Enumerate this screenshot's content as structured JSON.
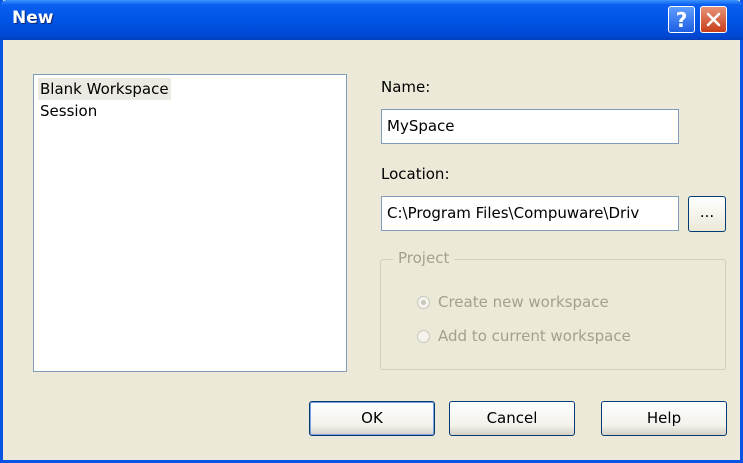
{
  "window": {
    "title": "New",
    "help_glyph": "?",
    "close_glyph": "✕"
  },
  "types": {
    "items": [
      "Blank Workspace",
      "Session"
    ],
    "selected": "Blank Workspace"
  },
  "name": {
    "label": "Name:",
    "value": "MySpace"
  },
  "location": {
    "label": "Location:",
    "value": "C:\\Program Files\\Compuware\\Driv",
    "browse_label": "..."
  },
  "project": {
    "legend": "Project",
    "options": [
      {
        "label": "Create new workspace",
        "checked": true
      },
      {
        "label": "Add to current workspace",
        "checked": false
      }
    ],
    "enabled": false
  },
  "buttons": {
    "ok": "OK",
    "cancel": "Cancel",
    "help": "Help"
  },
  "colors": {
    "titlebar": "#0055e5",
    "face": "#ece9d8",
    "disabled_text": "#a3a08f"
  }
}
